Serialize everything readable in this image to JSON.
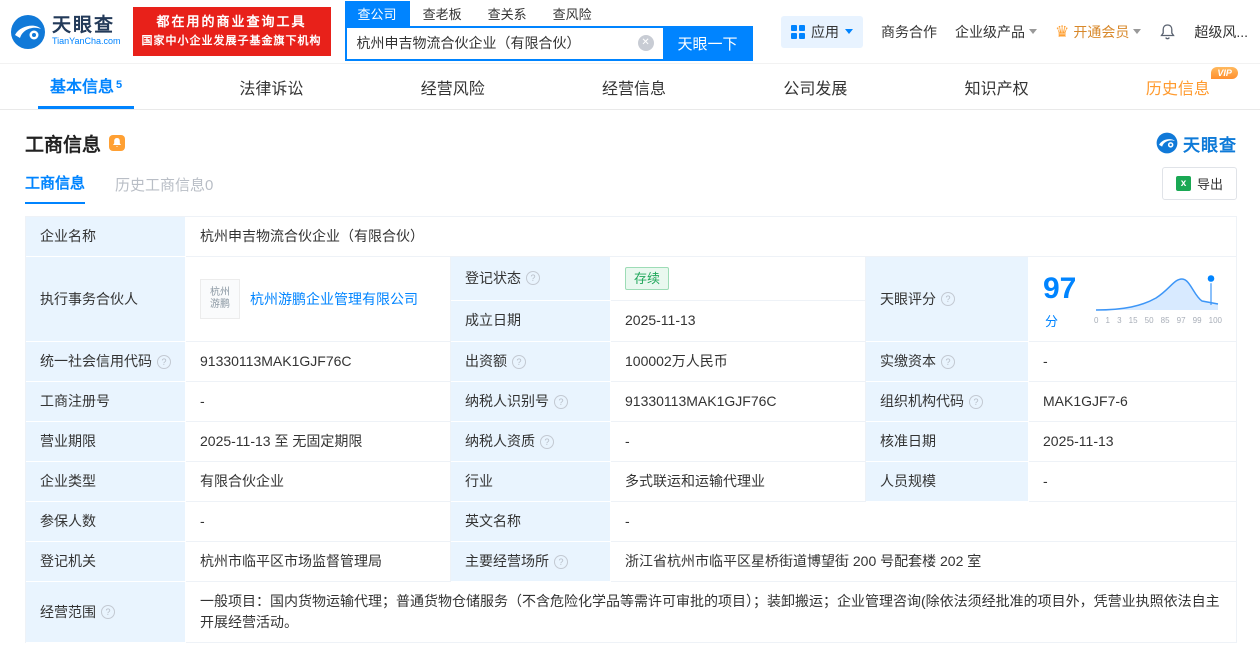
{
  "header": {
    "logo": {
      "title": "天眼查",
      "subtitle": "TianYanCha.com"
    },
    "promo": {
      "line1": "都在用的商业查询工具",
      "line2": "国家中小企业发展子基金旗下机构"
    },
    "search": {
      "tabs": [
        {
          "label": "查公司"
        },
        {
          "label": "查老板"
        },
        {
          "label": "查关系"
        },
        {
          "label": "查风险"
        }
      ],
      "value": "杭州申吉物流合伙企业（有限合伙）",
      "button": "天眼一下"
    },
    "menu": {
      "apps": "应用",
      "cooperation": "商务合作",
      "enterprise": "企业级产品",
      "vip": "开通会员",
      "risk": "超级风..."
    }
  },
  "nav": {
    "tabs": [
      {
        "label": "基本信息",
        "count": "5"
      },
      {
        "label": "法律诉讼"
      },
      {
        "label": "经营风险"
      },
      {
        "label": "经营信息"
      },
      {
        "label": "公司发展"
      },
      {
        "label": "知识产权"
      },
      {
        "label": "历史信息"
      }
    ],
    "vip_badge": "VIP"
  },
  "section": {
    "title": "工商信息",
    "brand": "天眼查",
    "tabs": [
      {
        "label": "工商信息"
      },
      {
        "label": "历史工商信息",
        "count": "0"
      }
    ],
    "export_label": "导出"
  },
  "table": {
    "company_name_label": "企业名称",
    "company_name": "杭州申吉物流合伙企业（有限合伙）",
    "partner_label": "执行事务合伙人",
    "partner_name": "杭州游鹏企业管理有限公司",
    "partner_logo_line1": "杭州",
    "partner_logo_line2": "游鹏",
    "reg_status_label": "登记状态",
    "reg_status": "存续",
    "establish_label": "成立日期",
    "establish_date": "2025-11-13",
    "credit_code_label": "统一社会信用代码",
    "credit_code": "91330113MAK1GJF76C",
    "capital_label": "出资额",
    "capital": "100002万人民币",
    "paid_label": "实缴资本",
    "paid": "-",
    "regno_label": "工商注册号",
    "regno": "-",
    "taxid_label": "纳税人识别号",
    "taxid": "91330113MAK1GJF76C",
    "orgcode_label": "组织机构代码",
    "orgcode": "MAK1GJF7-6",
    "term_label": "营业期限",
    "term": "2025-11-13 至 无固定期限",
    "taxquality_label": "纳税人资质",
    "taxquality": "-",
    "approval_label": "核准日期",
    "approval_date": "2025-11-13",
    "type_label": "企业类型",
    "type": "有限合伙企业",
    "industry_label": "行业",
    "industry": "多式联运和运输代理业",
    "staff_label": "人员规模",
    "staff": "-",
    "insured_label": "参保人数",
    "insured": "-",
    "english_label": "英文名称",
    "english_name": "-",
    "authority_label": "登记机关",
    "authority": "杭州市临平区市场监督管理局",
    "address_label": "主要经营场所",
    "address": "浙江省杭州市临平区星桥街道博望街 200 号配套楼 202 室",
    "scope_label": "经营范围",
    "scope": "一般项目：国内货物运输代理；普通货物仓储服务（不含危险化学品等需许可审批的项目）；装卸搬运；企业管理咨询(除依法须经批准的项目外，凭营业执照依法自主开展经营活动。"
  },
  "score": {
    "label": "天眼评分",
    "value": "97",
    "unit": "分",
    "axis": [
      "0",
      "1",
      "3",
      "15",
      "50",
      "85",
      "97",
      "99",
      "100"
    ]
  }
}
